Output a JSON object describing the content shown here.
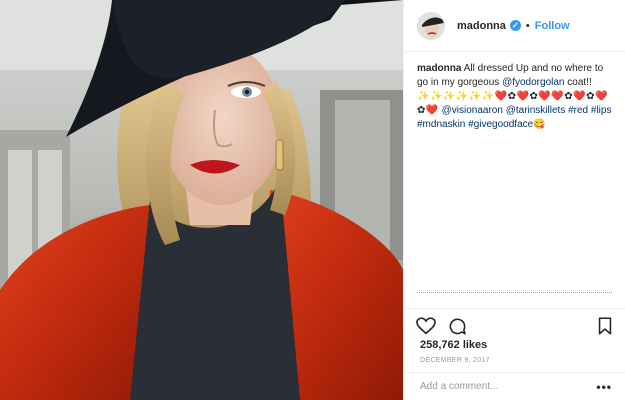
{
  "post": {
    "username": "madonna",
    "verified_icon": "verified-badge-icon",
    "separator": "•",
    "follow_label": "Follow"
  },
  "caption": {
    "username": "madonna",
    "text_1": " All dressed Up and no where to go in my gorgeous ",
    "mention_1": "@fyodorgolan",
    "text_2": " coat!! ",
    "emojis": "✨✨✨✨✨✨❤️✿❤️✿❤️❤️✿❤️✿❤️✿❤️",
    "mention_2": "@visionaaron",
    "mention_3": "@tarinskillets",
    "hashtag_1": "#red",
    "hashtag_2": "#lips",
    "hashtag_3": "#mdnaskin",
    "hashtag_4": "#givegoodface",
    "trailing_emoji": "😋"
  },
  "actions": {
    "like_icon": "heart-icon",
    "comment_icon": "comment-icon",
    "save_icon": "bookmark-icon"
  },
  "stats": {
    "likes": "258,762 likes",
    "date": "DECEMBER 9, 2017"
  },
  "comment": {
    "placeholder": "Add a comment...",
    "more_label": "•••"
  },
  "colors": {
    "accent": "#3897f0",
    "link": "#003569",
    "coat": "#c8290f",
    "hat": "#15191f"
  }
}
